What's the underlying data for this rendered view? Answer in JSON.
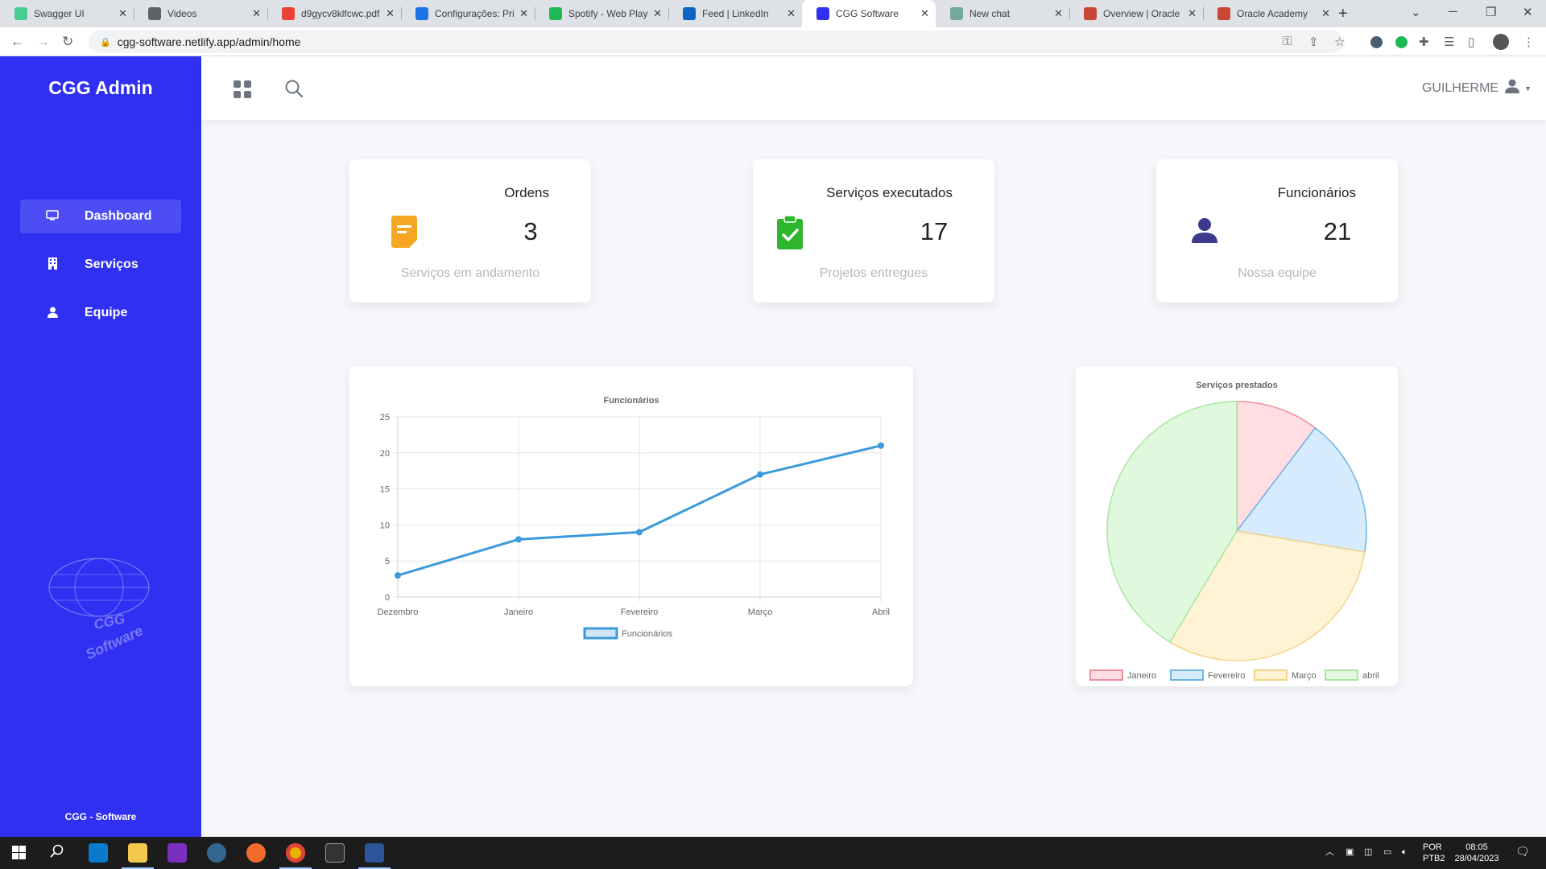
{
  "browser": {
    "tabs": [
      {
        "title": "Swagger UI",
        "icon": "swagger-icon",
        "color": "#49cc90"
      },
      {
        "title": "Videos",
        "icon": "gear-icon",
        "color": "#5f6368"
      },
      {
        "title": "d9gycv8klfcwc.pdf",
        "icon": "gmail-icon",
        "color": "#ea4335"
      },
      {
        "title": "Configurações: Pri",
        "icon": "settings-icon",
        "color": "#1a73e8"
      },
      {
        "title": "Spotify - Web Play",
        "icon": "spotify-icon",
        "color": "#1db954"
      },
      {
        "title": "Feed | LinkedIn",
        "icon": "linkedin-icon",
        "color": "#0a66c2"
      },
      {
        "title": "CGG Software",
        "icon": "netlify-icon",
        "color": "#3030f2",
        "active": true
      },
      {
        "title": "New chat",
        "icon": "chatgpt-icon",
        "color": "#74aa9c"
      },
      {
        "title": "Overview | Oracle",
        "icon": "oracle-icon",
        "color": "#c74634"
      },
      {
        "title": "Oracle Academy",
        "icon": "oracle-icon",
        "color": "#c74634"
      }
    ],
    "url": "cgg-software.netlify.app/admin/home"
  },
  "sidebar": {
    "brand": "CGG Admin",
    "items": [
      {
        "label": "Dashboard",
        "icon": "monitor-icon",
        "active": true
      },
      {
        "label": "Serviços",
        "icon": "building-icon",
        "active": false
      },
      {
        "label": "Equipe",
        "icon": "user-icon",
        "active": false
      }
    ],
    "logo_text_1": "CGG",
    "logo_text_2": "Software",
    "footer": "CGG - Software"
  },
  "header": {
    "username": "GUILHERME"
  },
  "stats": [
    {
      "title": "Ordens",
      "value": "3",
      "subtitle": "Serviços em andamento",
      "icon": "document-icon",
      "color": "#f5a623"
    },
    {
      "title": "Serviços executados",
      "value": "17",
      "subtitle": "Projetos entregues",
      "icon": "clipboard-check-icon",
      "color": "#2db52d"
    },
    {
      "title": "Funcionários",
      "value": "21",
      "subtitle": "Nossa equipe",
      "icon": "user-icon",
      "color": "#3d3a8c"
    }
  ],
  "chart_data": [
    {
      "type": "line",
      "title": "Funcionários",
      "categories": [
        "Dezembro",
        "Janeiro",
        "Fevereiro",
        "Março",
        "Abril"
      ],
      "series": [
        {
          "name": "Funcionários",
          "values": [
            3,
            8,
            9,
            17,
            21
          ]
        }
      ],
      "ylim": [
        0,
        25
      ],
      "yticks": [
        0,
        5,
        10,
        15,
        20,
        25
      ],
      "grid": true,
      "legend": "bottom",
      "color": "#3b9ad9"
    },
    {
      "type": "pie",
      "title": "Serviços prestados",
      "labels": [
        "Janeiro",
        "Fevereiro",
        "Março",
        "abril"
      ],
      "values": [
        3,
        5,
        9,
        12
      ],
      "colors": [
        "#ffdde3",
        "#d6ebfb",
        "#fff3d6",
        "#e0f8dd"
      ],
      "borders": [
        "#f08ca0",
        "#6cb4e8",
        "#f5d488",
        "#a9e6a0"
      ],
      "legend": "bottom"
    }
  ],
  "taskbar": {
    "language": "POR",
    "layout": "PTB2",
    "time": "08:05",
    "date": "28/04/2023"
  }
}
